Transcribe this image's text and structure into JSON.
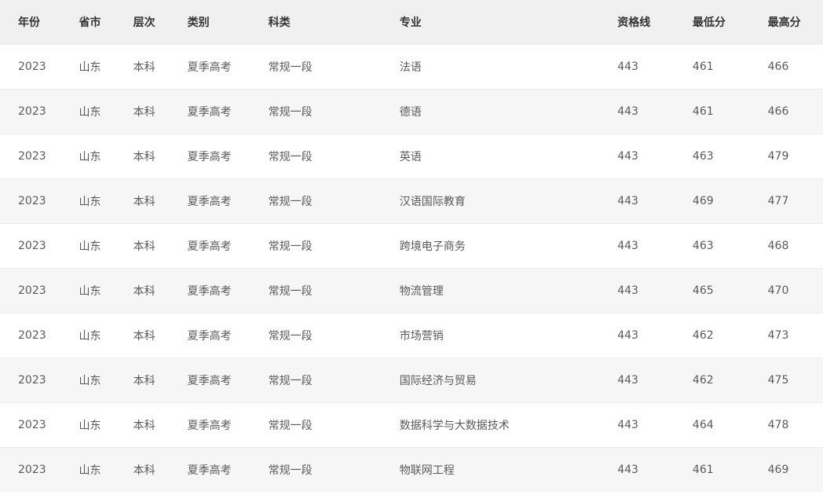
{
  "table": {
    "headers": [
      "年份",
      "省市",
      "层次",
      "类别",
      "科类",
      "专业",
      "资格线",
      "最低分",
      "最高分"
    ],
    "rows": [
      [
        "2023",
        "山东",
        "本科",
        "夏季高考",
        "常规一段",
        "法语",
        "443",
        "461",
        "466"
      ],
      [
        "2023",
        "山东",
        "本科",
        "夏季高考",
        "常规一段",
        "德语",
        "443",
        "461",
        "466"
      ],
      [
        "2023",
        "山东",
        "本科",
        "夏季高考",
        "常规一段",
        "英语",
        "443",
        "463",
        "479"
      ],
      [
        "2023",
        "山东",
        "本科",
        "夏季高考",
        "常规一段",
        "汉语国际教育",
        "443",
        "469",
        "477"
      ],
      [
        "2023",
        "山东",
        "本科",
        "夏季高考",
        "常规一段",
        "跨境电子商务",
        "443",
        "463",
        "468"
      ],
      [
        "2023",
        "山东",
        "本科",
        "夏季高考",
        "常规一段",
        "物流管理",
        "443",
        "465",
        "470"
      ],
      [
        "2023",
        "山东",
        "本科",
        "夏季高考",
        "常规一段",
        "市场营销",
        "443",
        "462",
        "473"
      ],
      [
        "2023",
        "山东",
        "本科",
        "夏季高考",
        "常规一段",
        "国际经济与贸易",
        "443",
        "462",
        "475"
      ],
      [
        "2023",
        "山东",
        "本科",
        "夏季高考",
        "常规一段",
        "数据科学与大数据技术",
        "443",
        "464",
        "478"
      ],
      [
        "2023",
        "山东",
        "本科",
        "夏季高考",
        "常规一段",
        "物联网工程",
        "443",
        "461",
        "469"
      ]
    ]
  }
}
